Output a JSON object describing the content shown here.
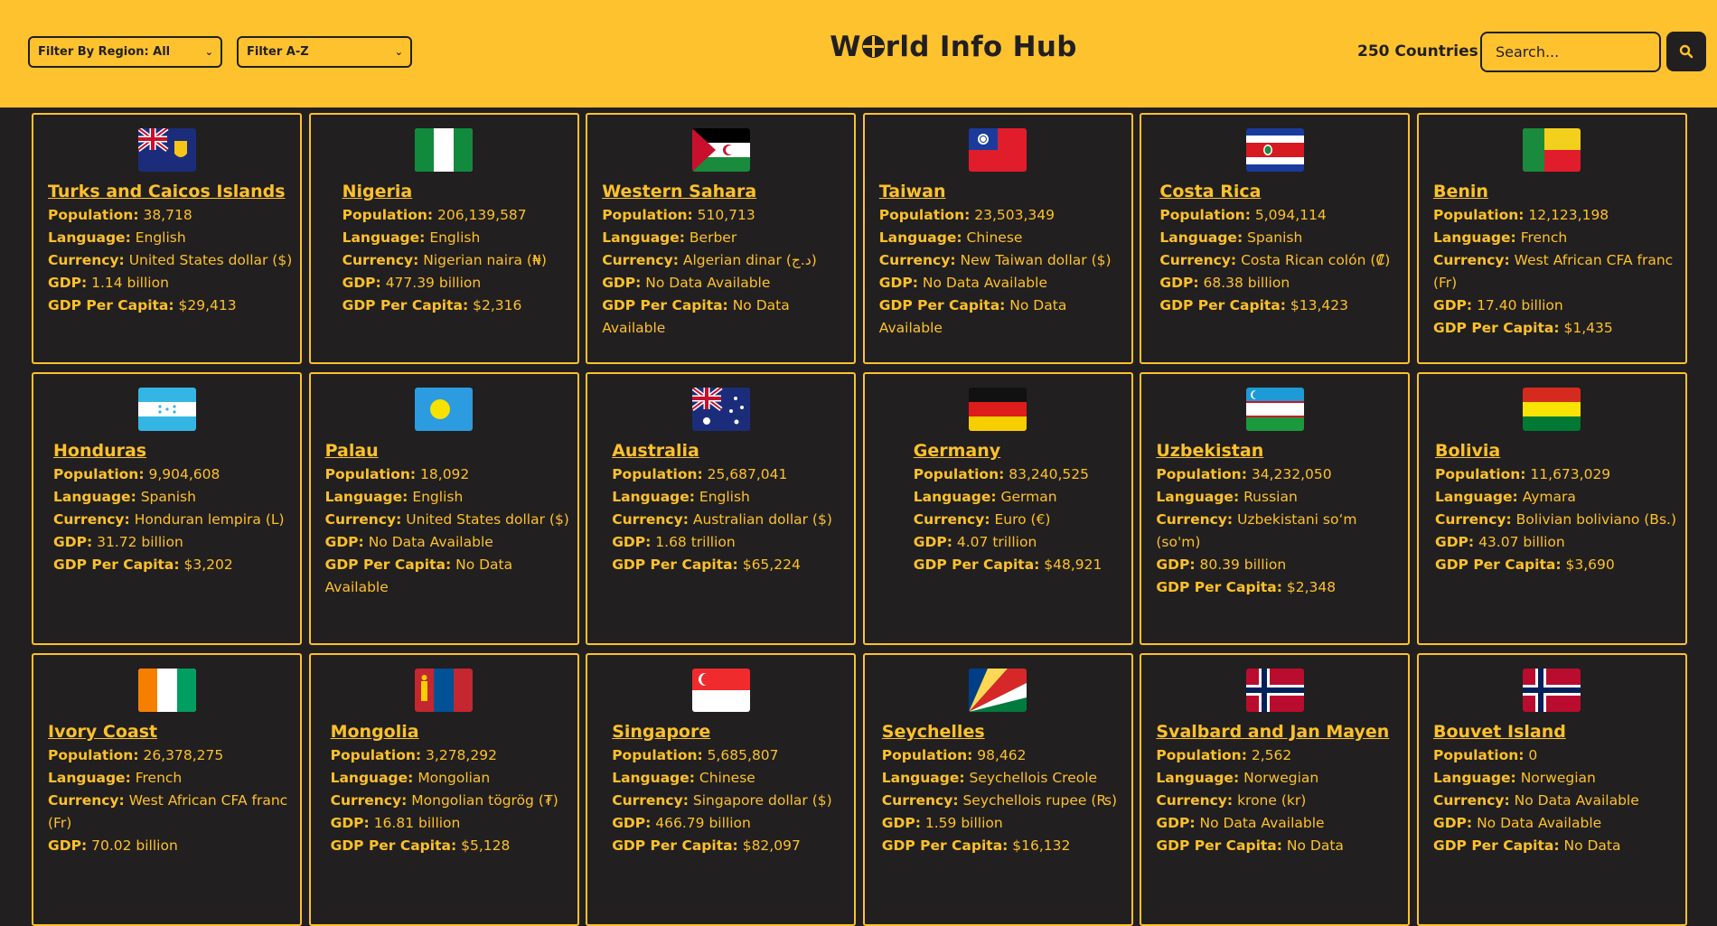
{
  "header": {
    "region_filter": "Filter By Region: All",
    "sort_filter": "Filter A-Z",
    "brand_before": "W",
    "brand_after": "rld Info Hub",
    "count_label": "250 Countries",
    "search_placeholder": "Search..."
  },
  "labels": {
    "population": "Population:",
    "language": "Language:",
    "currency": "Currency:",
    "gdp": "GDP:",
    "gdp_per_capita": "GDP Per Capita:"
  },
  "countries": [
    {
      "name": "Turks and Caicos Islands",
      "population": "38,718",
      "language": "English",
      "currency": "United States dollar ($)",
      "gdp": "1.14 billion",
      "gdp_per_capita": "$29,413",
      "flag": "turks-caicos-flag"
    },
    {
      "name": "Nigeria",
      "population": "206,139,587",
      "language": "English",
      "currency": "Nigerian naira (₦)",
      "gdp": "477.39 billion",
      "gdp_per_capita": "$2,316",
      "flag": "nigeria-flag"
    },
    {
      "name": "Western Sahara",
      "population": "510,713",
      "language": "Berber",
      "currency": "Algerian dinar (د.ج)",
      "gdp": "No Data Available",
      "gdp_per_capita": "No Data Available",
      "flag": "western-sahara-flag"
    },
    {
      "name": "Taiwan",
      "population": "23,503,349",
      "language": "Chinese",
      "currency": "New Taiwan dollar ($)",
      "gdp": "No Data Available",
      "gdp_per_capita": "No Data Available",
      "flag": "taiwan-flag"
    },
    {
      "name": "Costa Rica",
      "population": "5,094,114",
      "language": "Spanish",
      "currency": "Costa Rican colón (₡)",
      "gdp": "68.38 billion",
      "gdp_per_capita": "$13,423",
      "flag": "costa-rica-flag"
    },
    {
      "name": "Benin",
      "population": "12,123,198",
      "language": "French",
      "currency": "West African CFA franc (Fr)",
      "gdp": "17.40 billion",
      "gdp_per_capita": "$1,435",
      "flag": "benin-flag"
    },
    {
      "name": "Honduras",
      "population": "9,904,608",
      "language": "Spanish",
      "currency": "Honduran lempira (L)",
      "gdp": "31.72 billion",
      "gdp_per_capita": "$3,202",
      "flag": "honduras-flag"
    },
    {
      "name": "Palau",
      "population": "18,092",
      "language": "English",
      "currency": "United States dollar ($)",
      "gdp": "No Data Available",
      "gdp_per_capita": "No Data Available",
      "flag": "palau-flag"
    },
    {
      "name": "Australia",
      "population": "25,687,041",
      "language": "English",
      "currency": "Australian dollar ($)",
      "gdp": "1.68 trillion",
      "gdp_per_capita": "$65,224",
      "flag": "australia-flag"
    },
    {
      "name": "Germany",
      "population": "83,240,525",
      "language": "German",
      "currency": "Euro (€)",
      "gdp": "4.07 trillion",
      "gdp_per_capita": "$48,921",
      "flag": "germany-flag"
    },
    {
      "name": "Uzbekistan",
      "population": "34,232,050",
      "language": "Russian",
      "currency": "Uzbekistani soʻm (so'm)",
      "gdp": "80.39 billion",
      "gdp_per_capita": "$2,348",
      "flag": "uzbekistan-flag"
    },
    {
      "name": "Bolivia",
      "population": "11,673,029",
      "language": "Aymara",
      "currency": "Bolivian boliviano (Bs.)",
      "gdp": "43.07 billion",
      "gdp_per_capita": "$3,690",
      "flag": "bolivia-flag"
    },
    {
      "name": "Ivory Coast",
      "population": "26,378,275",
      "language": "French",
      "currency": "West African CFA franc (Fr)",
      "gdp": "70.02 billion",
      "gdp_per_capita": "",
      "flag": "ivory-coast-flag"
    },
    {
      "name": "Mongolia",
      "population": "3,278,292",
      "language": "Mongolian",
      "currency": "Mongolian tögrög (₮)",
      "gdp": "16.81 billion",
      "gdp_per_capita": "$5,128",
      "flag": "mongolia-flag"
    },
    {
      "name": "Singapore",
      "population": "5,685,807",
      "language": "Chinese",
      "currency": "Singapore dollar ($)",
      "gdp": "466.79 billion",
      "gdp_per_capita": "$82,097",
      "flag": "singapore-flag"
    },
    {
      "name": "Seychelles",
      "population": "98,462",
      "language": "Seychellois Creole",
      "currency": "Seychellois rupee (₨)",
      "gdp": "1.59 billion",
      "gdp_per_capita": "$16,132",
      "flag": "seychelles-flag"
    },
    {
      "name": "Svalbard and Jan Mayen",
      "population": "2,562",
      "language": "Norwegian",
      "currency": "krone (kr)",
      "gdp": "No Data Available",
      "gdp_per_capita": "No Data",
      "flag": "norway-flag"
    },
    {
      "name": "Bouvet Island",
      "population": "0",
      "language": "Norwegian",
      "currency": "No Data Available",
      "gdp": "No Data Available",
      "gdp_per_capita": "No Data",
      "flag": "norway-flag"
    }
  ]
}
